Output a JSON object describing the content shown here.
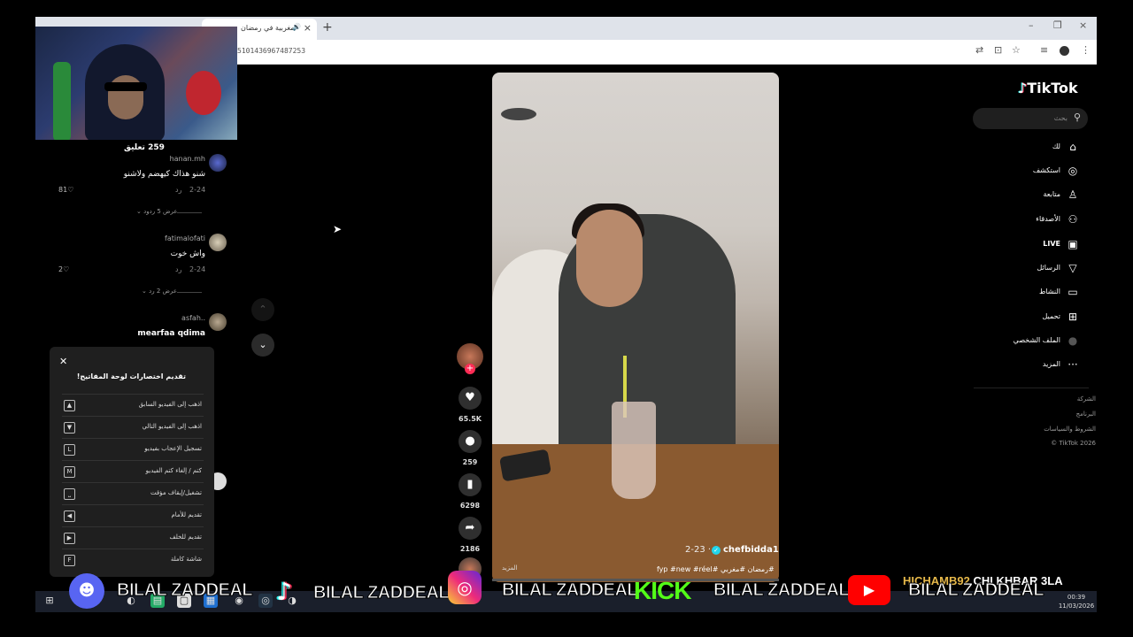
{
  "browser": {
    "tab_title": "مغربية في رمضان",
    "tab_audio_icon": "🔊",
    "close_glyph": "×",
    "new_tab_glyph": "+",
    "url": "5101436967487253",
    "window_controls": [
      "–",
      "❐",
      "×"
    ]
  },
  "comments": {
    "count_label": "259 تعليق",
    "items": [
      {
        "user": "hanan.mh",
        "text": "شنو هذاك كيهضم ولاشنو",
        "date": "2-24",
        "reply": "رد",
        "likes": "81",
        "replies": "عرض 5 ردود"
      },
      {
        "user": "fatimalofati",
        "text": "واش خوت",
        "date": "2-24",
        "reply": "رد",
        "likes": "2",
        "replies": "عرض 2 رد"
      },
      {
        "user": "asfah..",
        "text": "mearfaa qdima"
      }
    ]
  },
  "shortcuts": {
    "title": "تقديم اختصارات لوحة المفاتيح!",
    "items": [
      {
        "key": "▲",
        "label": "اذهب إلى الفيديو السابق"
      },
      {
        "key": "▼",
        "label": "اذهب إلى الفيديو التالي"
      },
      {
        "key": "L",
        "label": "تسجيل الإعجاب بفيديو"
      },
      {
        "key": "M",
        "label": "كتم / إلغاء كتم الفيديو"
      },
      {
        "key": "⎵",
        "label": "تشغيل/إيقاف مؤقت"
      },
      {
        "key": "◀",
        "label": "تقديم للأمام"
      },
      {
        "key": "▶",
        "label": "تقديم للخلف"
      },
      {
        "key": "F",
        "label": "شاشة كاملة"
      }
    ]
  },
  "video": {
    "author": "chefbidda1",
    "date": "2-23 ·",
    "hashtags": "#رمضان #مغربي #fyp #new #réel",
    "more": "المزيد",
    "progress": 0.0
  },
  "actions": {
    "likes": "65.5K",
    "comments": "259",
    "saves": "6298",
    "shares": "2186"
  },
  "sidebar": {
    "logo": "TikTok",
    "search_placeholder": "بحث",
    "items": [
      {
        "label": "لك",
        "icon": "⌂"
      },
      {
        "label": "استكشف",
        "icon": "◎"
      },
      {
        "label": "متابعة",
        "icon": "♙"
      },
      {
        "label": "الأصدقاء",
        "icon": "⚇"
      },
      {
        "label": "LIVE",
        "icon": "▣"
      },
      {
        "label": "الرسائل",
        "icon": "▽"
      },
      {
        "label": "النشاط",
        "icon": "▭"
      },
      {
        "label": "تحميل",
        "icon": "⊞"
      },
      {
        "label": "الملف الشخصي",
        "icon": "●"
      },
      {
        "label": "المزيد",
        "icon": "···"
      }
    ],
    "footer": [
      "الشركة",
      "البرنامج",
      "الشروط والسياسات",
      "© TikTok 2026"
    ]
  },
  "overlay": {
    "name": "BILAL ZADDEAL",
    "kick_label": "KICK",
    "ticker_name": "HICHAMB92",
    "ticker_text": "CHI KHBAR 3LA"
  },
  "taskbar": {
    "time": "00:39",
    "date": "11/03/2026"
  },
  "colors": {
    "accent": "#fe2c55",
    "cyan": "#25f4ee",
    "discord": "#5865f2",
    "kick": "#53fc18",
    "youtube": "#ff0000"
  }
}
